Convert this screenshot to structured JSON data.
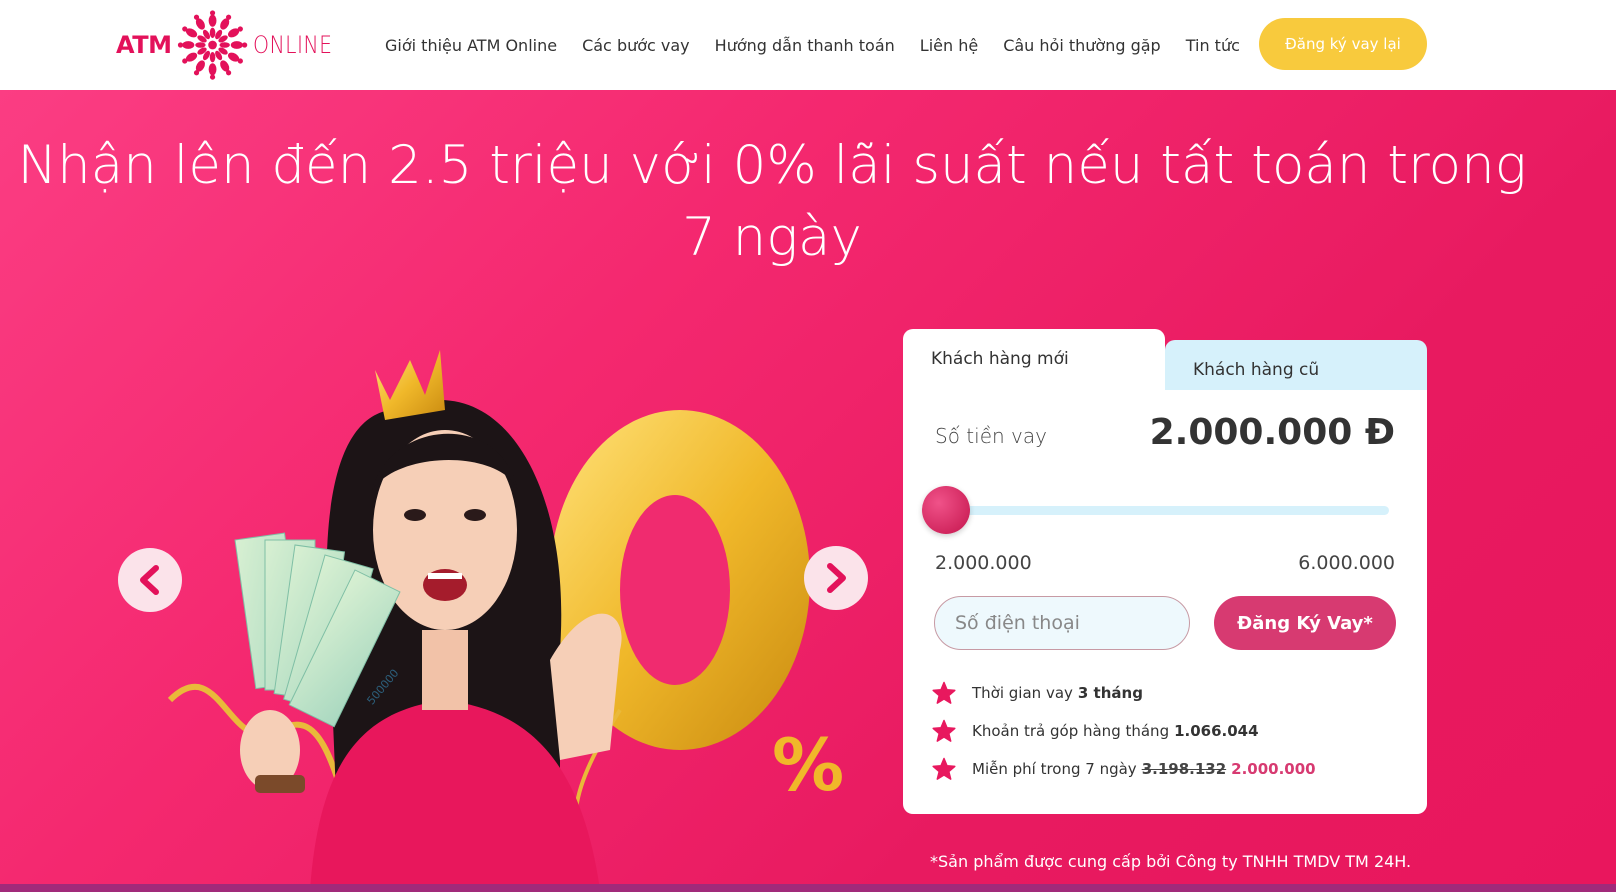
{
  "header": {
    "logo": {
      "left": "ATM",
      "right": "ONLINE"
    },
    "nav": [
      "Giới thiệu ATM Online",
      "Các bước vay",
      "Hướng dẫn thanh toán",
      "Liên hệ",
      "Câu hỏi thường gặp",
      "Tin tức"
    ],
    "cta": "Đăng ký vay lại"
  },
  "hero": {
    "title": "Nhận lên đến 2.5 triệu với 0% lãi suất nếu tất toán trong 7 ngày",
    "banknote_text": "500000",
    "footnote": "*Sản phẩm được cung cấp bởi Công ty TNHH TMDV TM 24H."
  },
  "loan_card": {
    "tabs": [
      "Khách hàng mới",
      "Khách hàng cũ"
    ],
    "active_tab": 0,
    "amount_label": "Số tiền vay",
    "amount_value": "2.000.000 Đ",
    "slider": {
      "min": "2.000.000",
      "max": "6.000.000",
      "value_fraction": 0
    },
    "phone_placeholder": "Số điện thoại",
    "submit_label": "Đăng Ký Vay*",
    "info": [
      {
        "text": "Thời gian vay",
        "strong": "3 tháng"
      },
      {
        "text": "Khoản trả góp hàng tháng",
        "strong": "1.066.044"
      },
      {
        "text": "Miễn phí trong 7 ngày",
        "strike": "3.198.132",
        "highlight": "2.000.000"
      }
    ]
  },
  "colors": {
    "brand": "#e3115a",
    "cta_yellow": "#f8ca3d",
    "hero_pink": "#f4286f",
    "button_pink": "#d73a71",
    "light_blue": "#d6f1fb"
  },
  "icons": [
    "flower-logo-icon",
    "chevron-left-icon",
    "chevron-right-icon",
    "star-icon"
  ]
}
